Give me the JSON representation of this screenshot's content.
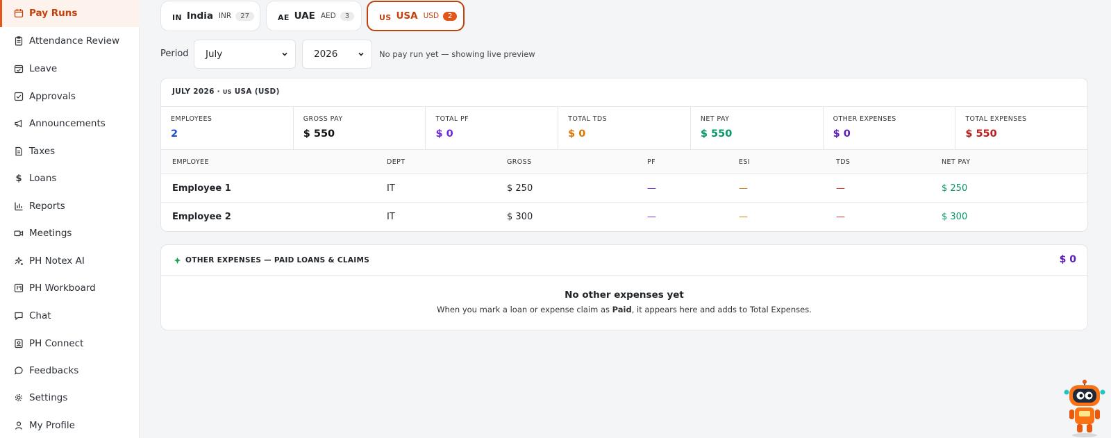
{
  "sidebar": {
    "items": [
      {
        "label": "Pay Runs",
        "icon": "calendar-icon"
      },
      {
        "label": "Attendance Review",
        "icon": "clipboard-icon"
      },
      {
        "label": "Leave",
        "icon": "calendar-check-icon"
      },
      {
        "label": "Approvals",
        "icon": "check-square-icon"
      },
      {
        "label": "Announcements",
        "icon": "megaphone-icon"
      },
      {
        "label": "Taxes",
        "icon": "document-icon"
      },
      {
        "label": "Loans",
        "icon": "dollar-icon"
      },
      {
        "label": "Reports",
        "icon": "bar-chart-icon"
      },
      {
        "label": "Meetings",
        "icon": "video-icon"
      },
      {
        "label": "PH Notex AI",
        "icon": "sparkles-icon"
      },
      {
        "label": "PH Workboard",
        "icon": "kanban-icon"
      },
      {
        "label": "Chat",
        "icon": "chat-icon"
      },
      {
        "label": "PH Connect",
        "icon": "contact-icon"
      },
      {
        "label": "Feedbacks",
        "icon": "message-circle-icon"
      },
      {
        "label": "Settings",
        "icon": "gear-icon"
      },
      {
        "label": "My Profile",
        "icon": "user-icon"
      }
    ]
  },
  "tabs": [
    {
      "code": "IN",
      "name": "India",
      "currency": "INR",
      "count": "27"
    },
    {
      "code": "AE",
      "name": "UAE",
      "currency": "AED",
      "count": "3"
    },
    {
      "code": "US",
      "name": "USA",
      "currency": "USD",
      "count": "2"
    }
  ],
  "period": {
    "label": "Period",
    "month": "July",
    "year": "2026",
    "note": "No pay run yet — showing live preview"
  },
  "summary": {
    "title_prefix": "JULY 2026 · ",
    "title_flag": "US",
    "title_suffix": " USA (USD)",
    "stats": [
      {
        "label": "EMPLOYEES",
        "value": "2",
        "color": "#1d4ed8"
      },
      {
        "label": "GROSS PAY",
        "value": "$ 550",
        "color": "#111111"
      },
      {
        "label": "TOTAL PF",
        "value": "$ 0",
        "color": "#6d28d9"
      },
      {
        "label": "TOTAL TDS",
        "value": "$ 0",
        "color": "#d97706"
      },
      {
        "label": "NET PAY",
        "value": "$ 550",
        "color": "#059669"
      },
      {
        "label": "OTHER EXPENSES",
        "value": "$ 0",
        "color": "#5b21b6"
      },
      {
        "label": "TOTAL EXPENSES",
        "value": "$ 550",
        "color": "#b91c1c"
      }
    ]
  },
  "table": {
    "headers": {
      "employee": "EMPLOYEE",
      "dept": "DEPT",
      "gross": "GROSS",
      "pf": "PF",
      "esi": "ESI",
      "tds": "TDS",
      "net": "NET PAY"
    },
    "rows": [
      {
        "employee": "Employee 1",
        "dept": "IT",
        "gross": "$ 250",
        "pf": "—",
        "esi": "—",
        "tds": "—",
        "net": "$ 250"
      },
      {
        "employee": "Employee 2",
        "dept": "IT",
        "gross": "$ 300",
        "pf": "—",
        "esi": "—",
        "tds": "—",
        "net": "$ 300"
      }
    ]
  },
  "other_expenses": {
    "title": "OTHER EXPENSES — PAID LOANS & CLAIMS",
    "total": "$ 0",
    "empty_title": "No other expenses yet",
    "empty_desc_1": "When you mark a loan or expense claim as ",
    "empty_desc_bold1": "Paid",
    "empty_desc_2": ", it appears here and adds to ",
    "empty_desc_bold2": "Total Expenses",
    "empty_desc_3": "."
  },
  "colors": {
    "accent": "#e2561c",
    "accent_dark": "#c2410c",
    "pf_dash": "#6d28d9",
    "esi_dash": "#d97706",
    "tds_dash": "#dc2626",
    "net": "#059669"
  }
}
